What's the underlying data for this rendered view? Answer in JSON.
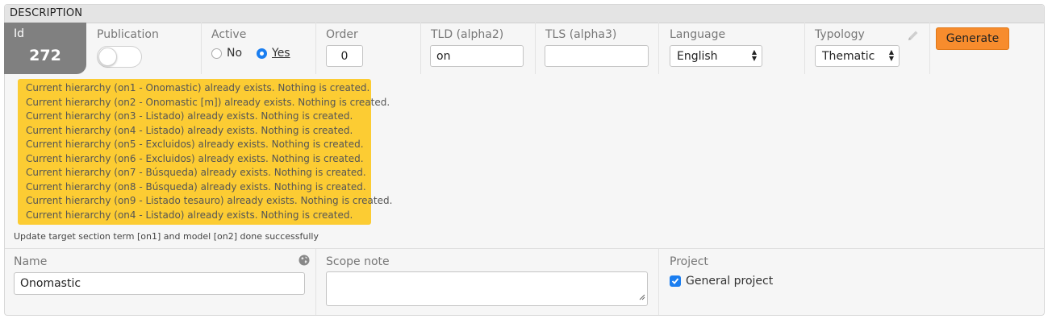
{
  "header": {
    "title": "DESCRIPTION"
  },
  "record": {
    "id_label": "Id",
    "id_value": "272"
  },
  "publication": {
    "label": "Publication",
    "enabled": false
  },
  "active": {
    "label": "Active",
    "options": [
      "No",
      "Yes"
    ],
    "selected": "Yes"
  },
  "order": {
    "label": "Order",
    "value": "0"
  },
  "tld": {
    "label": "TLD (alpha2)",
    "value": "on"
  },
  "tls": {
    "label": "TLS (alpha3)",
    "value": ""
  },
  "language": {
    "label": "Language",
    "value": "English"
  },
  "typology": {
    "label": "Typology",
    "value": "Thematic"
  },
  "generate": {
    "label": "Generate"
  },
  "messages": [
    "Current hierarchy (on1 - Onomastic) already exists. Nothing is created.",
    "Current hierarchy (on2 - Onomastic [m]) already exists. Nothing is created.",
    "Current hierarchy (on3 - Listado) already exists. Nothing is created.",
    "Current hierarchy (on4 - Listado) already exists. Nothing is created.",
    "Current hierarchy (on5 - Excluidos) already exists. Nothing is created.",
    "Current hierarchy (on6 - Excluidos) already exists. Nothing is created.",
    "Current hierarchy (on7 - Búsqueda) already exists. Nothing is created.",
    "Current hierarchy (on8 - Búsqueda) already exists. Nothing is created.",
    "Current hierarchy (on9 - Listado tesauro) already exists. Nothing is created.",
    "Current hierarchy (on4 - Listado) already exists. Nothing is created."
  ],
  "success_message": "Update target section term [on1] and model [on2] done successfully",
  "name": {
    "label": "Name",
    "value": "Onomastic"
  },
  "scope_note": {
    "label": "Scope note",
    "value": ""
  },
  "project": {
    "label": "Project",
    "checkbox_label": "General project",
    "checked": true
  },
  "colors": {
    "accent": "#1b7ef0",
    "generate": "#f78c2d",
    "message_bg": "#fccc33",
    "id_bg": "#808080"
  },
  "icons": {
    "edit": "pencil-icon",
    "translate": "globe-icon"
  }
}
